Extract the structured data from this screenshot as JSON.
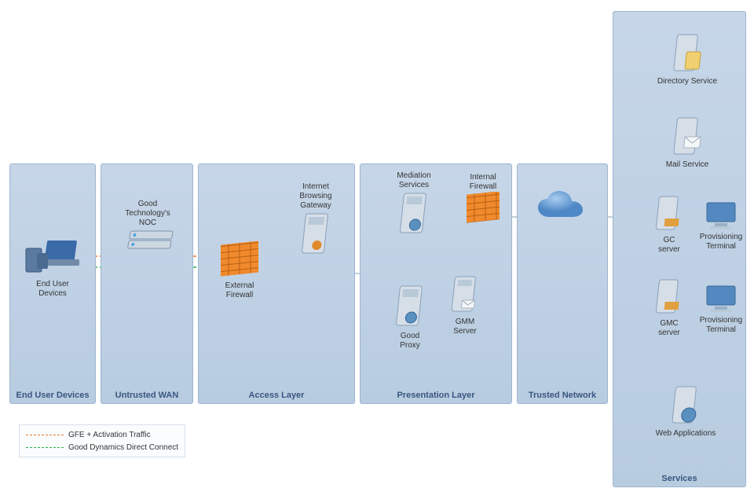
{
  "zones": {
    "endUser": "End User Devices",
    "untrustedWan": "Untrusted WAN",
    "access": "Access  Layer",
    "presentation": "Presentation Layer",
    "trusted": "Trusted Network",
    "services": "Services"
  },
  "nodes": {
    "endUserDevices": "End User\nDevices",
    "noc": "Good\nTechnology's\nNOC",
    "extFirewall": "External\nFirewall",
    "ibg": "Internet\nBrowsing\nGateway",
    "mediation": "Mediation\nServices",
    "intFirewall": "Internal\nFirewall",
    "goodProxy": "Good\nProxy",
    "gmm": "GMM\nServer",
    "directory": "Directory Service",
    "mail": "Mail Service",
    "gc": "GC\nserver",
    "gmc": "GMC\nserver",
    "prov1": "Provisioning\nTerminal",
    "prov2": "Provisioning\nTerminal",
    "web": "Web Applications"
  },
  "legend": {
    "gfe": "GFE + Activation Traffic",
    "gddc": "Good Dynamics Direct Connect"
  }
}
